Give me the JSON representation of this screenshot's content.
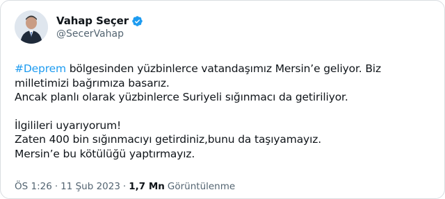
{
  "author": {
    "display_name": "Vahap Seçer",
    "handle": "@SecerVahap",
    "verified": true,
    "verified_color": "#1d9bf0"
  },
  "tweet": {
    "hashtag": "#Deprem",
    "line1_rest": " bölgesinden yüzbinlerce vatandaşımız Mersin’e geliyor. Biz",
    "line2": "milletimizi bağrımıza basarız.",
    "line3": "Ancak planlı olarak yüzbinlerce Suriyeli sığınmacı da getiriliyor.",
    "line4": "İlgilileri uyarıyorum!",
    "line5": "Zaten 400 bin sığınmacıyı getirdiniz,bunu da taşıyamayız.",
    "line6": "Mersin’e bu kötülüğü yaptırmayız."
  },
  "meta": {
    "time": "ÖS 1:26",
    "separator": "·",
    "date": "11 Şub 2023",
    "views_count": "1,7 Mn",
    "views_label": "Görüntülenme"
  },
  "colors": {
    "text": "#0f1419",
    "secondary": "#536471",
    "accent": "#1d9bf0"
  }
}
